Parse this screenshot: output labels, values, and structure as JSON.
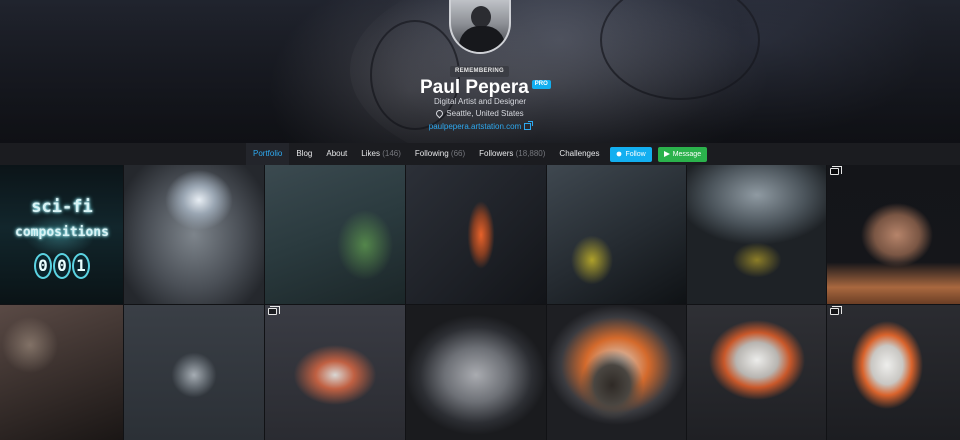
{
  "profile": {
    "badge": "REMEMBERING",
    "name": "Paul Pepera",
    "pro_label": "PRO",
    "headline": "Digital Artist and Designer",
    "location": "Seattle, United States",
    "website": "paulpepera.artstation.com",
    "avatar_icon": "avatar-photo",
    "location_icon": "map-pin-icon",
    "website_icon": "external-link-icon"
  },
  "nav": {
    "portfolio": "Portfolio",
    "blog": "Blog",
    "about": "About",
    "likes_label": "Likes",
    "likes_count": "(146)",
    "following_label": "Following",
    "following_count": "(66)",
    "followers_label": "Followers",
    "followers_count": "(18,880)",
    "challenges": "Challenges",
    "follow_button": "Follow",
    "message_button": "Message"
  },
  "colors": {
    "accent": "#13aff0",
    "message": "#2bb24c",
    "background": "#111215"
  },
  "gallery": {
    "first_tile": {
      "line1": "sci-fi",
      "line2": "compositions",
      "digits": [
        "0",
        "0",
        "1"
      ]
    },
    "row1_multi_icon": [
      false,
      false,
      false,
      false,
      false,
      false,
      true
    ],
    "row2_multi_icon": [
      false,
      false,
      true,
      false,
      false,
      false,
      true
    ]
  }
}
